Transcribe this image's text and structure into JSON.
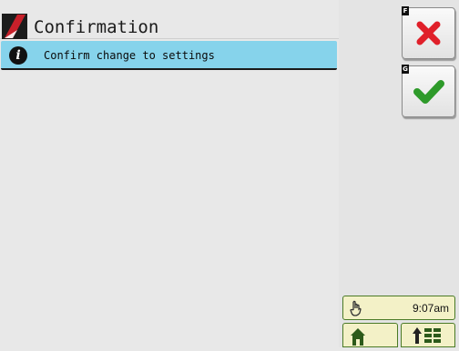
{
  "header": {
    "title": "Confirmation"
  },
  "message": {
    "icon": "info-icon",
    "text": "Confirm change to settings"
  },
  "softkeys": [
    {
      "key": "F",
      "icon": "close-icon",
      "color": "#e0202a"
    },
    {
      "key": "G",
      "icon": "check-icon",
      "color": "#2e9a2a"
    }
  ],
  "status": {
    "time": "9:07am",
    "icon": "operator-hand-icon"
  },
  "nav": [
    {
      "icon": "home-icon"
    },
    {
      "icon": "up-arrow-grid-menu-icon"
    }
  ],
  "colors": {
    "message_bg": "#86d3eb",
    "status_bg": "#f3f1c7",
    "status_border": "#4a7a26",
    "brand_red": "#c8202a"
  }
}
